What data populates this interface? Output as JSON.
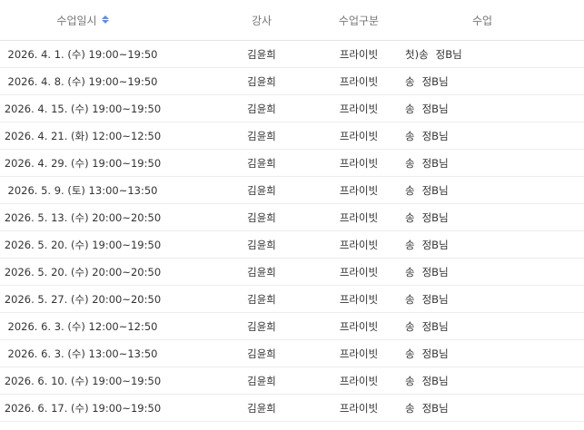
{
  "table": {
    "columns": {
      "date": "수업일시",
      "teacher": "강사",
      "type": "수업구분",
      "class": "수업"
    },
    "sort_icon": "sort-toggle-icon",
    "accent_color": "#6b8cd4",
    "rows": [
      {
        "date": "2026. 4. 1. (수) 19:00~19:50",
        "teacher": "김윤희",
        "type": "프라이빗",
        "class_prefix": "첫)송",
        "student": "정B님"
      },
      {
        "date": "2026. 4. 8. (수) 19:00~19:50",
        "teacher": "김윤희",
        "type": "프라이빗",
        "class_prefix": "송",
        "student": "정B님"
      },
      {
        "date": "2026. 4. 15. (수) 19:00~19:50",
        "teacher": "김윤희",
        "type": "프라이빗",
        "class_prefix": "송",
        "student": "정B님"
      },
      {
        "date": "2026. 4. 21. (화) 12:00~12:50",
        "teacher": "김윤희",
        "type": "프라이빗",
        "class_prefix": "송",
        "student": "정B님"
      },
      {
        "date": "2026. 4. 29. (수) 19:00~19:50",
        "teacher": "김윤희",
        "type": "프라이빗",
        "class_prefix": "송",
        "student": "정B님"
      },
      {
        "date": "2026. 5. 9. (토) 13:00~13:50",
        "teacher": "김윤희",
        "type": "프라이빗",
        "class_prefix": "송",
        "student": "정B님"
      },
      {
        "date": "2026. 5. 13. (수) 20:00~20:50",
        "teacher": "김윤희",
        "type": "프라이빗",
        "class_prefix": "송",
        "student": "정B님"
      },
      {
        "date": "2026. 5. 20. (수) 19:00~19:50",
        "teacher": "김윤희",
        "type": "프라이빗",
        "class_prefix": "송",
        "student": "정B님"
      },
      {
        "date": "2026. 5. 20. (수) 20:00~20:50",
        "teacher": "김윤희",
        "type": "프라이빗",
        "class_prefix": "송",
        "student": "정B님"
      },
      {
        "date": "2026. 5. 27. (수) 20:00~20:50",
        "teacher": "김윤희",
        "type": "프라이빗",
        "class_prefix": "송",
        "student": "정B님"
      },
      {
        "date": "2026. 6. 3. (수) 12:00~12:50",
        "teacher": "김윤희",
        "type": "프라이빗",
        "class_prefix": "송",
        "student": "정B님"
      },
      {
        "date": "2026. 6. 3. (수) 13:00~13:50",
        "teacher": "김윤희",
        "type": "프라이빗",
        "class_prefix": "송",
        "student": "정B님"
      },
      {
        "date": "2026. 6. 10. (수) 19:00~19:50",
        "teacher": "김윤희",
        "type": "프라이빗",
        "class_prefix": "송",
        "student": "정B님"
      },
      {
        "date": "2026. 6. 17. (수) 19:00~19:50",
        "teacher": "김윤희",
        "type": "프라이빗",
        "class_prefix": "송",
        "student": "정B님"
      }
    ]
  }
}
